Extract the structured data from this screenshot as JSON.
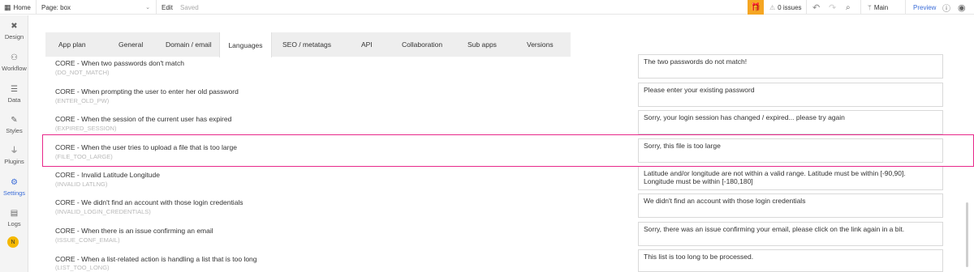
{
  "topbar": {
    "home": "Home",
    "page_label": "Page: box",
    "edit": "Edit",
    "saved": "Saved",
    "issues": "0 issues",
    "branch": "Main",
    "preview": "Preview"
  },
  "sidebar": {
    "items": [
      {
        "label": "Design"
      },
      {
        "label": "Workflow"
      },
      {
        "label": "Data"
      },
      {
        "label": "Styles"
      },
      {
        "label": "Plugins"
      },
      {
        "label": "Settings"
      },
      {
        "label": "Logs"
      }
    ],
    "avatar": "N"
  },
  "tabs": [
    {
      "label": "App plan"
    },
    {
      "label": "General"
    },
    {
      "label": "Domain / email"
    },
    {
      "label": "Languages"
    },
    {
      "label": "SEO / metatags"
    },
    {
      "label": "API"
    },
    {
      "label": "Collaboration"
    },
    {
      "label": "Sub apps"
    },
    {
      "label": "Versions"
    }
  ],
  "active_tab": "Languages",
  "rows": [
    {
      "label": "CORE - When two passwords don't match",
      "key": "(DO_NOT_MATCH)",
      "value": "The two passwords do not match!"
    },
    {
      "label": "CORE - When prompting the user to enter her old password",
      "key": "(ENTER_OLD_PW)",
      "value": "Please enter your existing password"
    },
    {
      "label": "CORE - When the session of the current user has expired",
      "key": "(EXPIRED_SESSION)",
      "value": "Sorry, your login session has changed / expired... please try again"
    },
    {
      "label": "CORE - When the user tries to upload a file that is too large",
      "key": "(FILE_TOO_LARGE)",
      "value": "Sorry, this file is too large"
    },
    {
      "label": "CORE - Invalid Latitude Longitude",
      "key": "(INVALID LATLNG)",
      "value": "Latitude and/or longitude are not within a valid range. Latitude must be within [-90,90]. Longitude must be within [-180,180]"
    },
    {
      "label": "CORE - We didn't find an account with those login credentials",
      "key": "(INVALID_LOGIN_CREDENTIALS)",
      "value": "We didn't find an account with those login credentials"
    },
    {
      "label": "CORE - When there is an issue confirming an email",
      "key": "(ISSUE_CONF_EMAIL)",
      "value": "Sorry, there was an issue confirming your email, please click on the link again in a bit."
    },
    {
      "label": "CORE - When a list-related action is handling a list that is too long",
      "key": "(LIST_TOO_LONG)",
      "value": "This list is too long to be processed."
    }
  ]
}
